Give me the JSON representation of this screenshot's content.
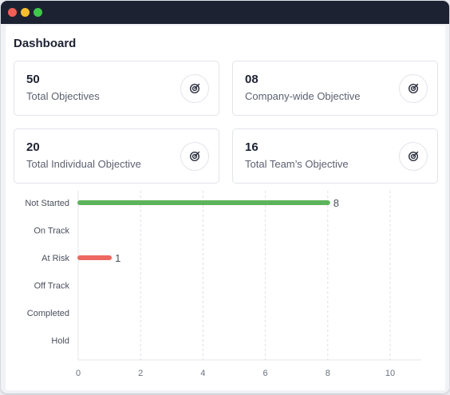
{
  "window": {
    "controls": {
      "close_color": "#f25f57",
      "minimize_color": "#f6be2f",
      "maximize_color": "#3fc94a"
    }
  },
  "dashboard": {
    "title": "Dashboard",
    "cards": [
      {
        "value": "50",
        "label": "Total Objectives",
        "icon": "target-icon"
      },
      {
        "value": "08",
        "label": "Company-wide Objective",
        "icon": "target-icon"
      },
      {
        "value": "20",
        "label": "Total Individual Objective",
        "icon": "target-icon"
      },
      {
        "value": "16",
        "label": "Total Team’s Objective",
        "icon": "target-icon"
      }
    ]
  },
  "chart_data": {
    "type": "bar",
    "orientation": "horizontal",
    "categories": [
      "Not Started",
      "On Track",
      "At Risk",
      "Off Track",
      "Completed",
      "Hold"
    ],
    "values": [
      8,
      null,
      1,
      null,
      null,
      null
    ],
    "value_labels": [
      "8",
      "",
      "1",
      "",
      "",
      ""
    ],
    "bar_colors": [
      "#5db35a",
      null,
      "#ee6862",
      null,
      null,
      null
    ],
    "x_ticks": [
      "0",
      "2",
      "4",
      "6",
      "8",
      "10"
    ],
    "xlim": [
      0,
      10
    ],
    "grid": "vertical dashed",
    "title": "",
    "xlabel": "",
    "ylabel": ""
  }
}
